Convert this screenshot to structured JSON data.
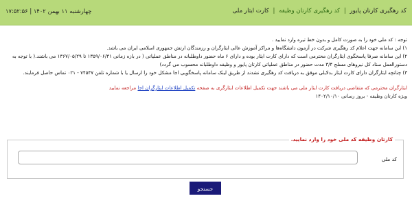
{
  "header": {
    "title": "کد رهگیری کارتان پایور",
    "breadcrumb_link": "کد رهگیری کارتان وظیفه",
    "breadcrumb_active": "کارت ایثار ملی",
    "date": "چهارشنبه ۱۱ بهمن ۱۴۰۲",
    "time": "۱۷:۵۲:۵۶"
  },
  "notice": {
    "intro": "توجه : کد ملی خود را به صورت کامل و بدون خط تیره وارد نمایید .",
    "item1": "۱) این سامانه جهت اعلام کد رهگیری شرکت در آزمون دانشگاه‌ها و مراکز آموزش عالی ایثارگران و رزمندگان ارتش جمهوری اسلامی ایران می باشد.",
    "item2": "۲) این سامانه صرفا پاسخگوی ایثارگران محترمی است که دارای کارت ایثار بوده و دارای ۶ ماه حضور داوطلبانه در مناطق عملیاتی ( در بازه زمانی ۱۳۵۹/۰۶/۳۱ تا ۱۳۶۷/۰۵/۲۹ می باشند.( با توجه به دستورالعمل ستاد کل نیروهای مسلح ۳/۴ مدت حضور در مناطق عملیاتی کارتان پایور و وظیفه داوطلبانه محسوب می گردد)",
    "item3": "۳) چنانچه ایثارگران دارای کارت ایثار بدلایلی موفق به دریافت کد رهگیری نشدند از طریق لینک سامانه پاسخگویی اجا مشکل خود را ارسال یا با شماره تلفن ۷۴۵۴۷ - ۰۲۱ تماس حاصل فرمایند.",
    "red_notice": "ایثارگران محترمی که متقاضی دریافت کارت ایثار ملی می باشند جهت تکمیل اطلاعات ایثارگری به صفحه",
    "red_link": "تکمیل اطلاعات ایثارگران اجا",
    "red_suffix": "مراجعه نمایید",
    "update_line": "ویژه کارتان وظیفه - بروز رسانی ۱۴۰۲/۱۰/۱۰"
  },
  "form": {
    "legend": "کارتان وظیفه کد ملی خود را وارد نمایید.",
    "national_code_label": "کد ملی",
    "national_code_value": "",
    "submit_label": "جستجو"
  }
}
